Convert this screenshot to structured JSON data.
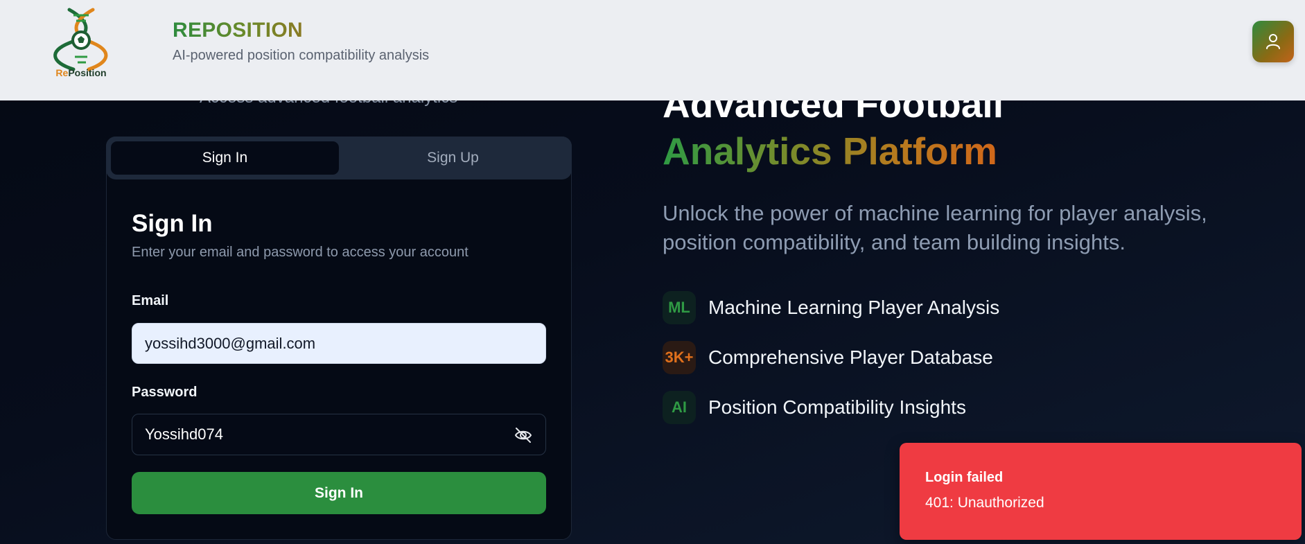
{
  "header": {
    "logo_text": "RePosition",
    "title": "REPOSITION",
    "subtitle": "AI-powered position compatibility analysis",
    "profile_icon": "user-icon"
  },
  "auth": {
    "tagline": "Access advanced football analytics",
    "tabs": [
      {
        "label": "Sign In",
        "active": true
      },
      {
        "label": "Sign Up",
        "active": false
      }
    ],
    "card_title": "Sign In",
    "card_subtitle": "Enter your email and password to access your account",
    "email_label": "Email",
    "email_value": "yossihd3000@gmail.com",
    "password_label": "Password",
    "password_value": "Yossihd074",
    "password_toggle_icon": "eye-off-icon",
    "submit_label": "Sign In"
  },
  "hero": {
    "line1": "Advanced Football",
    "line2": "Analytics Platform",
    "description": "Unlock the power of machine learning for player analysis, position compatibility, and team building insights.",
    "features": [
      {
        "badge": "ML",
        "label": "Machine Learning Player Analysis",
        "color": "#2f9a44"
      },
      {
        "badge": "3K+",
        "label": "Comprehensive Player Database",
        "color": "#e0701c"
      },
      {
        "badge": "AI",
        "label": "Position Compatibility Insights",
        "color": "#2f9a44"
      }
    ]
  },
  "toast": {
    "title": "Login failed",
    "message": "401: Unauthorized",
    "color": "#ef3b42"
  },
  "colors": {
    "brand_green": "#2b8e3e",
    "brand_orange": "#d0671a",
    "background": "#050a16",
    "header_bg": "#eceef2"
  }
}
